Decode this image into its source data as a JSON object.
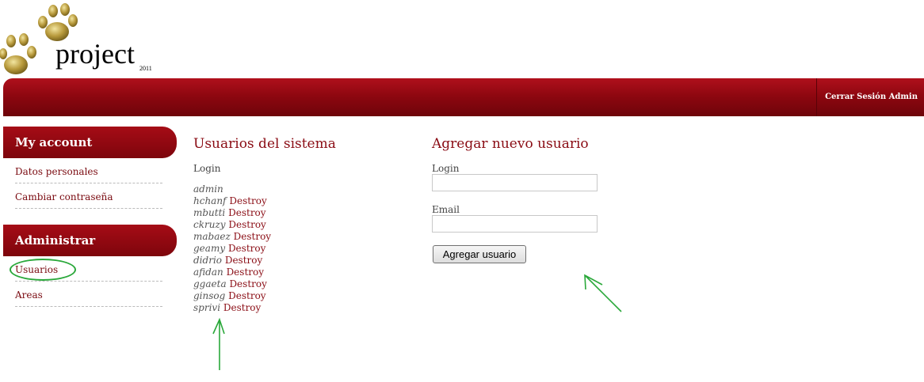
{
  "header": {
    "logo_text": "project",
    "logo_year": "2011",
    "logout_label": "Cerrar Sesión Admin"
  },
  "sidebar": {
    "sections": [
      {
        "title": "My account",
        "items": [
          {
            "label": "Datos personales"
          },
          {
            "label": "Cambiar contraseña"
          }
        ]
      },
      {
        "title": "Administrar",
        "items": [
          {
            "label": "Usuarios"
          },
          {
            "label": "Areas"
          }
        ]
      }
    ]
  },
  "users": {
    "title": "Usuarios del sistema",
    "column_header": "Login",
    "destroy_label": "Destroy",
    "rows": [
      {
        "login": "admin",
        "destroy": ""
      },
      {
        "login": "hchanf",
        "destroy": "Destroy"
      },
      {
        "login": "mbutti",
        "destroy": "Destroy"
      },
      {
        "login": "ckruzy",
        "destroy": "Destroy"
      },
      {
        "login": "mabaez",
        "destroy": "Destroy"
      },
      {
        "login": "geamy",
        "destroy": "Destroy"
      },
      {
        "login": "didrio",
        "destroy": "Destroy"
      },
      {
        "login": "afidan",
        "destroy": "Destroy"
      },
      {
        "login": "ggaeta",
        "destroy": "Destroy"
      },
      {
        "login": "ginsog",
        "destroy": "Destroy"
      },
      {
        "login": "sprivi",
        "destroy": "Destroy"
      }
    ]
  },
  "new_user_form": {
    "title": "Agregar nuevo usuario",
    "login_label": "Login",
    "login_value": "",
    "email_label": "Email",
    "email_value": "",
    "submit_label": "Agregar usuario"
  },
  "colors": {
    "brand_red": "#8e0710",
    "link_red": "#8a0c14",
    "annotation_green": "#2aa83a"
  }
}
